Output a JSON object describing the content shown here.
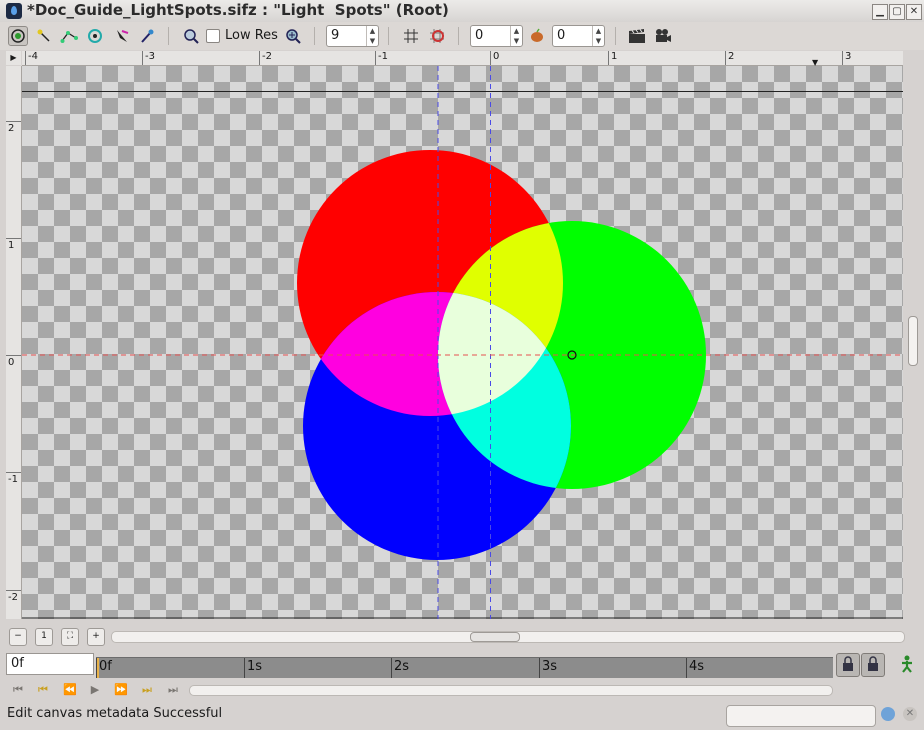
{
  "window": {
    "title": "*Doc_Guide_LightSpots.sifz : \"Light  Spots\" (Root)"
  },
  "toolbar": {
    "low_res_label": "Low Res",
    "low_res_checked": false,
    "quality_value": "9",
    "onion_past_value": "0",
    "onion_future_value": "0",
    "icons": [
      "transform-tool-icon",
      "smooth-move-icon",
      "scale-tool-icon",
      "rotate-tool-icon",
      "mirror-tool-icon",
      "circle-tool-icon",
      "zoom-icon",
      "grid-icon",
      "snap-icon",
      "onion-skin-icon",
      "render-icon",
      "preview-icon"
    ]
  },
  "ruler": {
    "h_labels": [
      "-4",
      "-3",
      "-2",
      "-1",
      "0",
      "1",
      "2",
      "3"
    ],
    "v_labels": [
      "2",
      "1",
      "0",
      "-1",
      "-2"
    ]
  },
  "canvas": {
    "spots": [
      {
        "name": "red",
        "color": "#ff0000"
      },
      {
        "name": "green",
        "color": "#00ff00"
      },
      {
        "name": "blue",
        "color": "#0000ff"
      }
    ],
    "overlap_colors": {
      "red_green": "#e0ff00",
      "red_blue": "#ff00e0",
      "green_blue": "#00ffe0",
      "all": "#e8ffdc"
    }
  },
  "timebar": {
    "current_time": "0f",
    "ticks": [
      "0f",
      "1s",
      "2s",
      "3s",
      "4s"
    ]
  },
  "status": {
    "message": "Edit canvas metadata Successful"
  }
}
